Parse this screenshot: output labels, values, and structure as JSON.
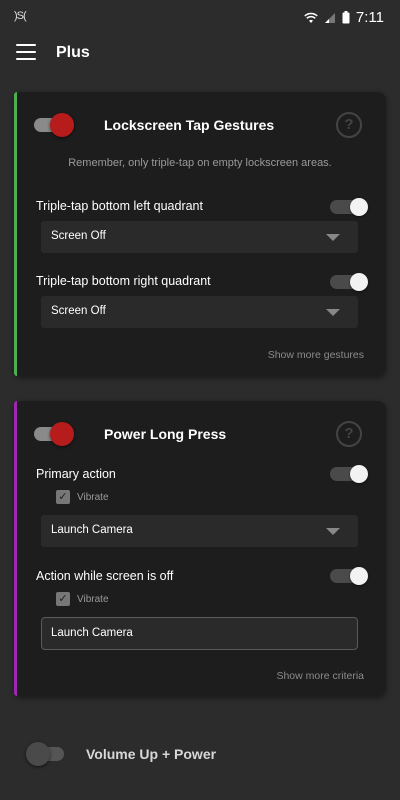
{
  "status_bar": {
    "left_text": ")S(",
    "time": "7:11",
    "icons": [
      "wifi-icon",
      "signal-icon",
      "battery-icon"
    ]
  },
  "app_bar": {
    "title": "Plus",
    "menu_icon": "hamburger-menu-icon"
  },
  "colors": {
    "background": "#2c2c2c",
    "card": "#1d1d1d",
    "accent_green": "#4caf50",
    "accent_purple": "#9c27b0",
    "toggle_red": "#b71c1c"
  },
  "cards": [
    {
      "title": "Lockscreen Tap Gestures",
      "enabled": true,
      "help": "?",
      "hint": "Remember, only triple-tap on empty lockscreen areas.",
      "rows": [
        {
          "label": "Triple-tap bottom left quadrant",
          "enabled": true,
          "value": "Screen Off"
        },
        {
          "label": "Triple-tap bottom right quadrant",
          "enabled": true,
          "value": "Screen Off"
        }
      ],
      "more_link": "Show more gestures"
    },
    {
      "title": "Power Long Press",
      "enabled": true,
      "help": "?",
      "rows": [
        {
          "label": "Primary action",
          "enabled": true,
          "checkbox_label": "Vibrate",
          "checkbox_checked": true,
          "value": "Launch Camera"
        },
        {
          "label": "Action while screen is off",
          "enabled": true,
          "checkbox_label": "Vibrate",
          "checkbox_checked": true,
          "value": "Launch Camera"
        }
      ],
      "more_link": "Show more criteria"
    }
  ],
  "bottom_item": {
    "title": "Volume Up + Power",
    "enabled": false
  },
  "check_mark": "✓"
}
